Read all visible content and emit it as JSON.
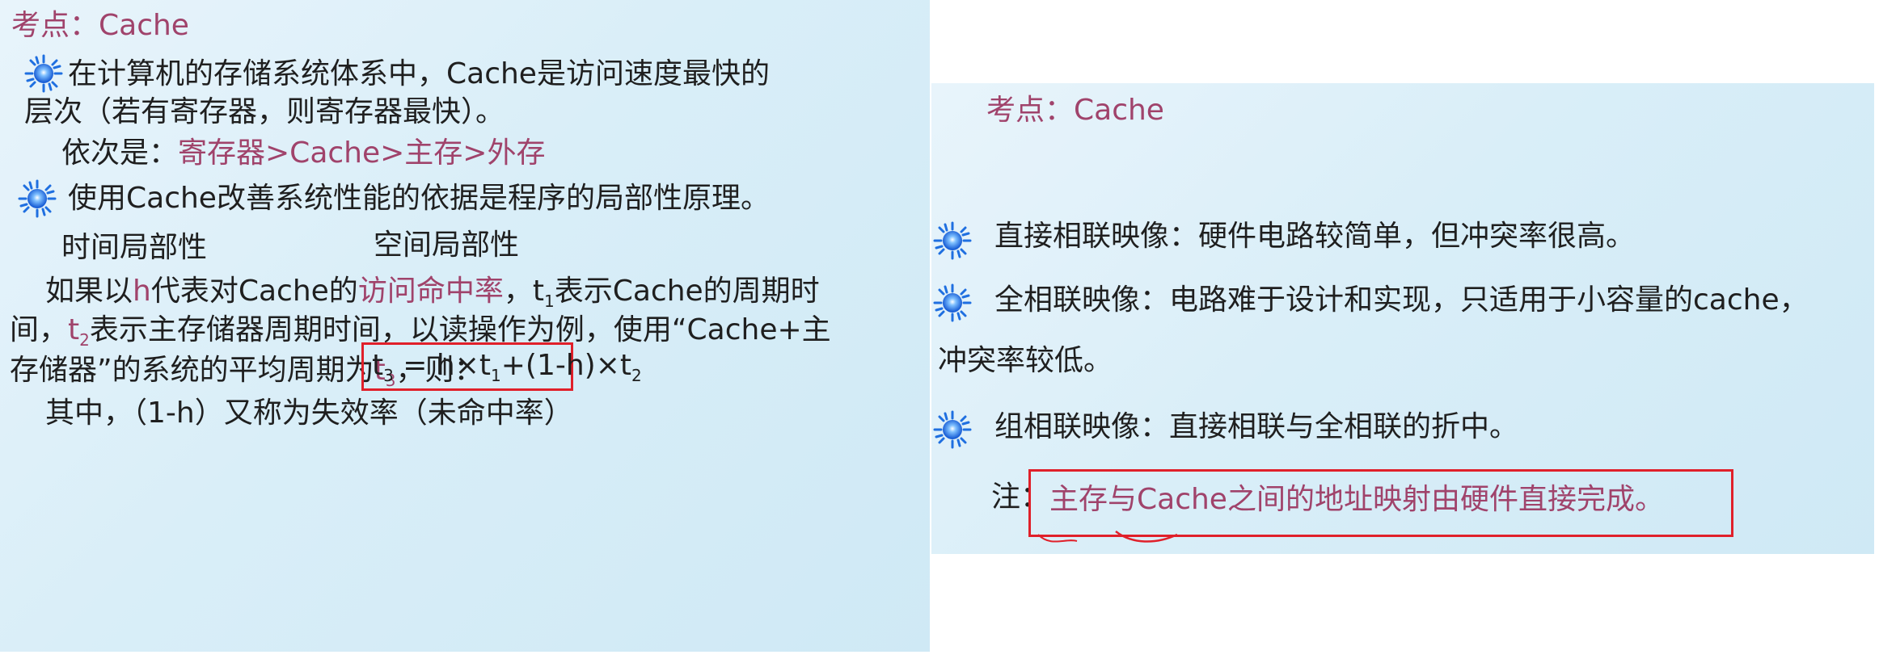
{
  "left": {
    "title": "考点：Cache",
    "bullet1_line1": "在计算机的存储系统体系中，Cache是访问速度最快的",
    "bullet1_line2": "层次（若有寄存器，则寄存器最快）。",
    "order_label": "依次是：",
    "order_value": "寄存器>Cache>主存>外存",
    "bullet2": "使用Cache改善系统性能的依据是程序的局部性原理。",
    "temporal": "时间局部性",
    "spatial": "空间局部性",
    "p_a1": "如果以",
    "p_h": "h",
    "p_a2": "代表对Cache的",
    "p_hitrate": "访问命中率",
    "p_a3": "，",
    "p_t": "t",
    "p_sub1": "1",
    "p_a4": "表示Cache的周期时",
    "p_b1": "间，",
    "p_b_t": "t",
    "p_sub2": "2",
    "p_b2": "表示主存储器周期时间，以读操作为例，使用“Cache+主",
    "p_c1": "存储器”的系统的平均周期为",
    "p_c_t": "t",
    "p_sub3": "3",
    "p_c2": "，则：",
    "f_t": "t",
    "f_s3": "3",
    "f_eq": " = h×t",
    "f_s1": "1",
    "f_mid": "+(1-h)×t",
    "f_s2": "2",
    "miss_note": "其中，（1-h）又称为失效率（未命中率）"
  },
  "right": {
    "title": "考点：Cache",
    "direct": "直接相联映像：硬件电路较简单，但冲突率很高。",
    "full_line1": "全相联映像：电路难于设计和实现，只适用于小容量的cache，",
    "full_line2": "冲突率较低。",
    "set": "组相联映像：直接相联与全相联的折中。",
    "note_label": "注：",
    "note_text": "主存与Cache之间的地址映射由硬件直接完成。"
  },
  "colors": {
    "accent": "#a0436b",
    "box": "#e0202a",
    "icon": "#1f6fe0"
  }
}
